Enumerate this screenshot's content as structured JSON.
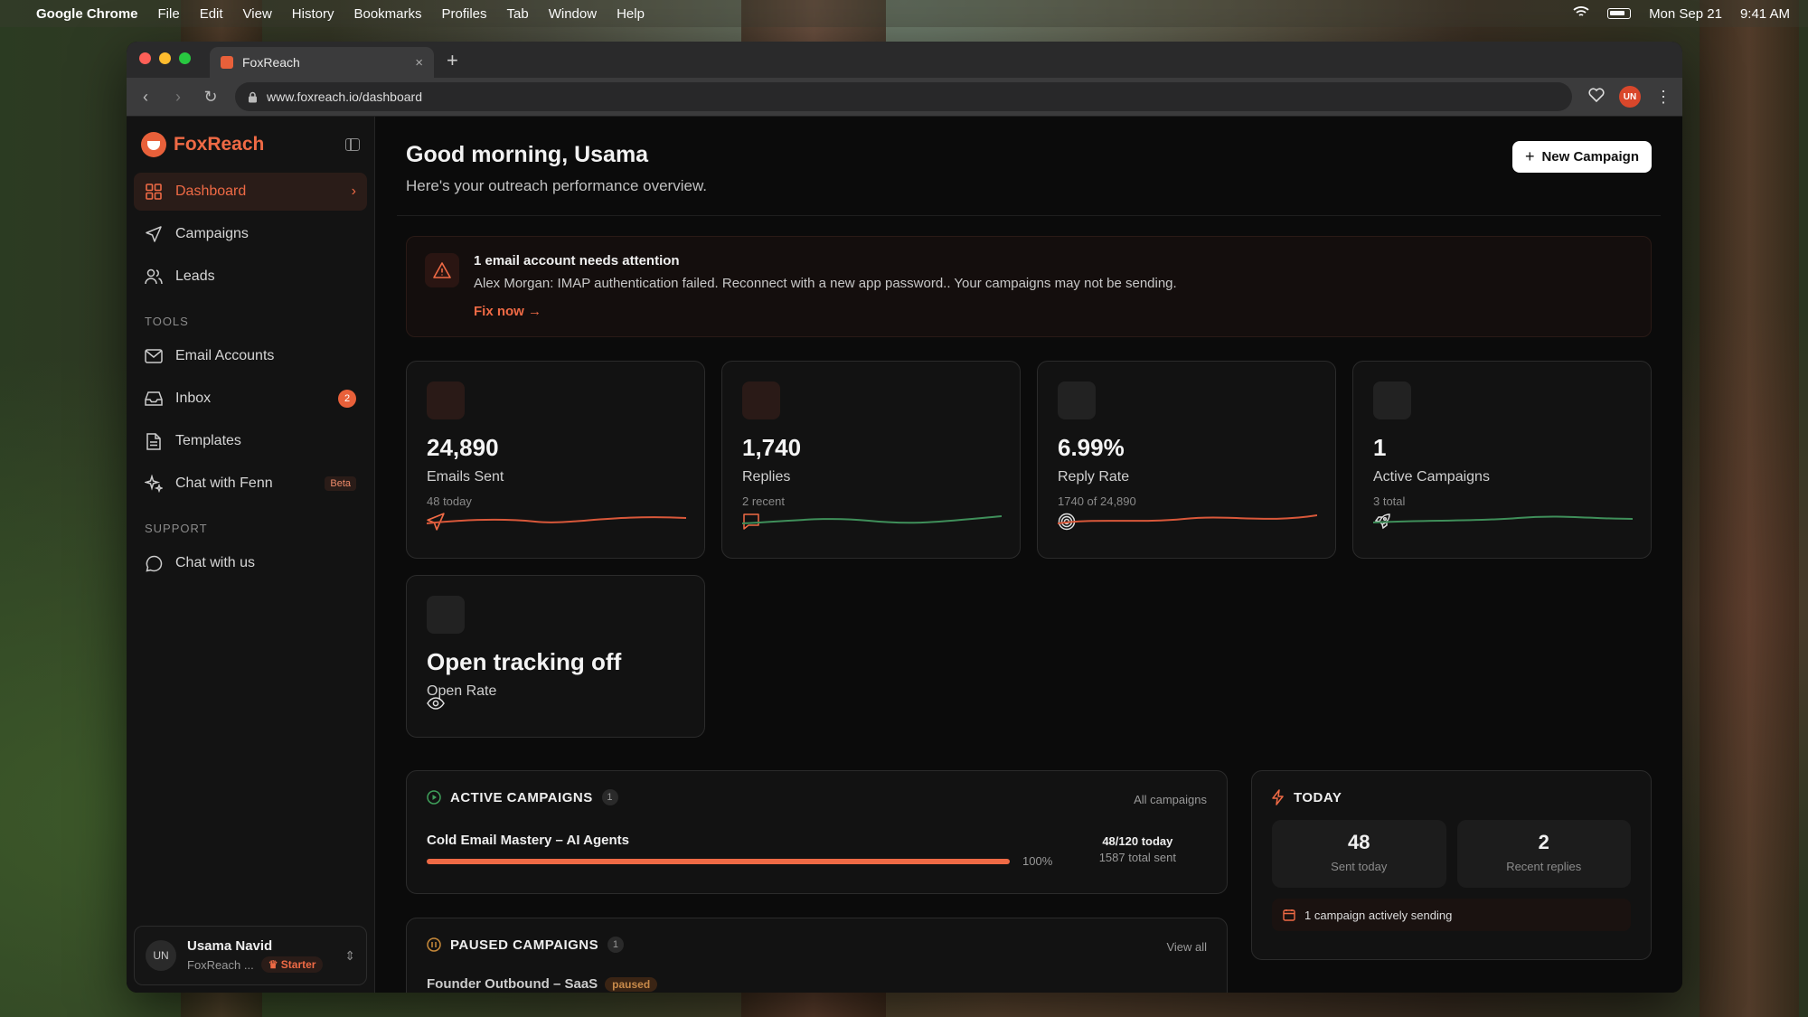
{
  "menubar": {
    "app": "Google Chrome",
    "items": [
      "File",
      "Edit",
      "View",
      "History",
      "Bookmarks",
      "Profiles",
      "Tab",
      "Window",
      "Help"
    ],
    "date": "Mon Sep 21",
    "time": "9:41 AM"
  },
  "browser": {
    "tab_title": "FoxReach",
    "url": "www.foxreach.io/dashboard",
    "profile_initials": "UN"
  },
  "sidebar": {
    "brand": "FoxReach",
    "main_items": [
      {
        "label": "Dashboard",
        "icon": "grid-icon"
      },
      {
        "label": "Campaigns",
        "icon": "send-icon"
      },
      {
        "label": "Leads",
        "icon": "users-icon"
      }
    ],
    "tools_label": "TOOLS",
    "tools_items": [
      {
        "label": "Email Accounts",
        "icon": "mail-icon"
      },
      {
        "label": "Inbox",
        "icon": "inbox-icon",
        "badge": "2"
      },
      {
        "label": "Templates",
        "icon": "document-icon"
      },
      {
        "label": "Chat with Fenn",
        "icon": "sparkle-icon",
        "tag": "Beta"
      }
    ],
    "support_label": "SUPPORT",
    "support_items": [
      {
        "label": "Chat with us",
        "icon": "chat-icon"
      }
    ],
    "user": {
      "initials": "UN",
      "name": "Usama Navid",
      "org": "FoxReach ...",
      "plan": "Starter"
    }
  },
  "header": {
    "greeting": "Good morning, Usama",
    "subtitle": "Here's your outreach performance overview.",
    "new_campaign": "New Campaign"
  },
  "alert": {
    "title": "1 email account needs attention",
    "message": "Alex Morgan: IMAP authentication failed. Reconnect with a new app password.. Your campaigns may not be sending.",
    "action": "Fix now →"
  },
  "stats": [
    {
      "value": "24,890",
      "label": "Emails Sent",
      "sub": "48 today",
      "icon": "send-icon",
      "spark_color": "#d9583a"
    },
    {
      "value": "1,740",
      "label": "Replies",
      "sub": "2 recent",
      "icon": "message-icon",
      "spark_color": "#3f8f5a"
    },
    {
      "value": "6.99%",
      "label": "Reply Rate",
      "sub": "1740 of 24,890",
      "icon": "target-icon",
      "spark_color": "#d9583a"
    },
    {
      "value": "1",
      "label": "Active Campaigns",
      "sub": "3 total",
      "icon": "rocket-icon",
      "spark_color": "#3f8f5a"
    }
  ],
  "open_tracking": {
    "value": "Open tracking off",
    "label": "Open Rate",
    "icon": "eye-icon"
  },
  "active_campaigns": {
    "title": "ACTIVE CAMPAIGNS",
    "count": "1",
    "link": "All campaigns",
    "items": [
      {
        "name": "Cold Email Mastery – AI Agents",
        "progress": 1.0,
        "pct": "100%",
        "today": "48/120 today",
        "total": "1587 total sent"
      }
    ]
  },
  "paused_campaigns": {
    "title": "PAUSED CAMPAIGNS",
    "count": "1",
    "link": "View all",
    "items": [
      {
        "name": "Founder Outbound – SaaS",
        "status": "paused"
      }
    ]
  },
  "today": {
    "title": "TODAY",
    "sent": "48",
    "sent_label": "Sent today",
    "replies": "2",
    "replies_label": "Recent replies",
    "sending": "1 campaign actively sending"
  }
}
